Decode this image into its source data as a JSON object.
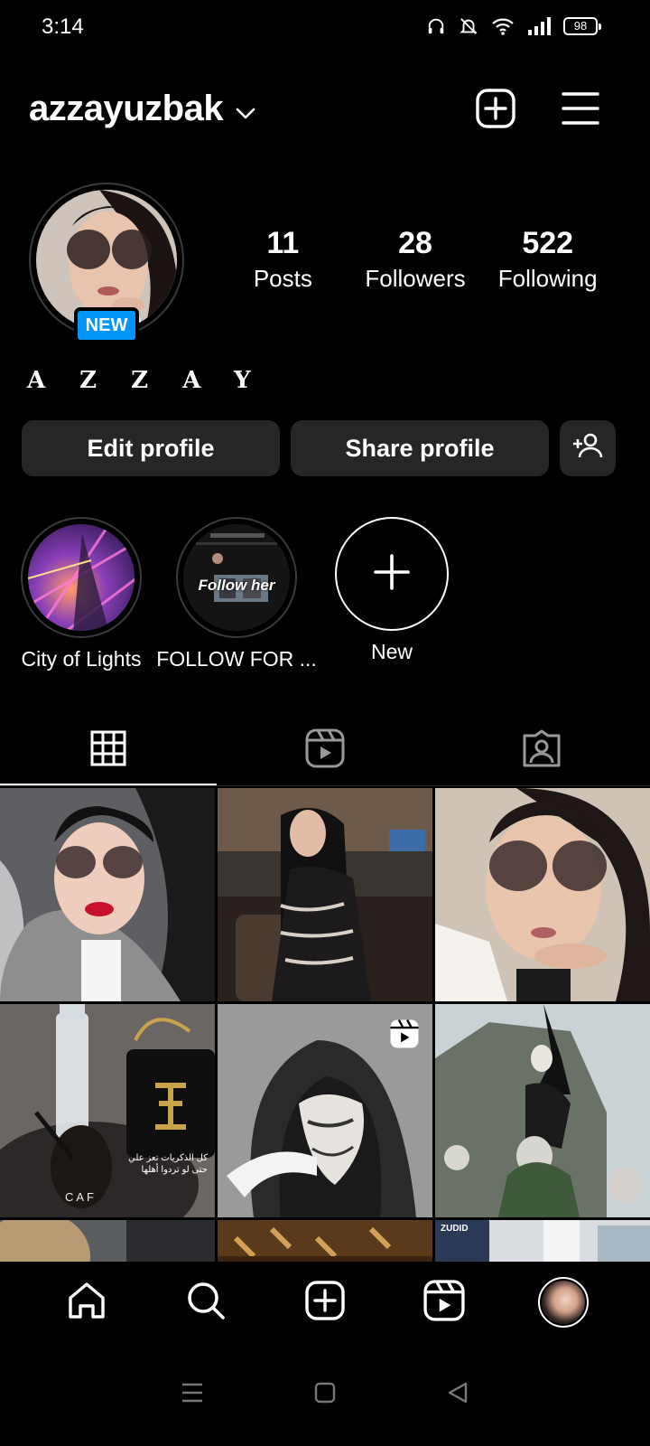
{
  "status_bar": {
    "time": "3:14",
    "battery": "98",
    "icons": [
      "headphones-icon",
      "bell-muted-icon",
      "wifi-icon",
      "signal-icon",
      "battery-icon"
    ]
  },
  "header": {
    "username": "azzayuzbak",
    "icons": [
      "chevron-down-icon",
      "create-icon",
      "menu-icon"
    ]
  },
  "profile": {
    "new_badge": "NEW",
    "stats": [
      {
        "value": "11",
        "label": "Posts"
      },
      {
        "value": "28",
        "label": "Followers"
      },
      {
        "value": "522",
        "label": "Following"
      }
    ],
    "display_name": "AZZAY"
  },
  "actions": {
    "edit_label": "Edit profile",
    "share_label": "Share profile",
    "discover_icon": "add-person-icon"
  },
  "highlights": [
    {
      "label": "City of Lights"
    },
    {
      "label": "FOLLOW FOR ...",
      "overlay_text": "Follow her"
    },
    {
      "label": "New"
    }
  ],
  "tabs": [
    {
      "name": "posts",
      "icon": "grid-icon",
      "active": true
    },
    {
      "name": "reels",
      "icon": "reels-icon",
      "active": false
    },
    {
      "name": "tagged",
      "icon": "tagged-icon",
      "active": false
    }
  ],
  "grid": {
    "post_count_visible": 9,
    "reel_badge_on": 5,
    "overlay_caption": "كل الذكريات تعز علي\nحتى لو تردوا أهلها",
    "cup_text": "CAF",
    "corner_text": "ZUDID"
  },
  "bottom_nav": [
    "home-icon",
    "search-icon",
    "create-post-icon",
    "reels-icon",
    "profile-avatar"
  ],
  "colors": {
    "background": "#000000",
    "button": "#262626",
    "accent": "#0095f6"
  }
}
